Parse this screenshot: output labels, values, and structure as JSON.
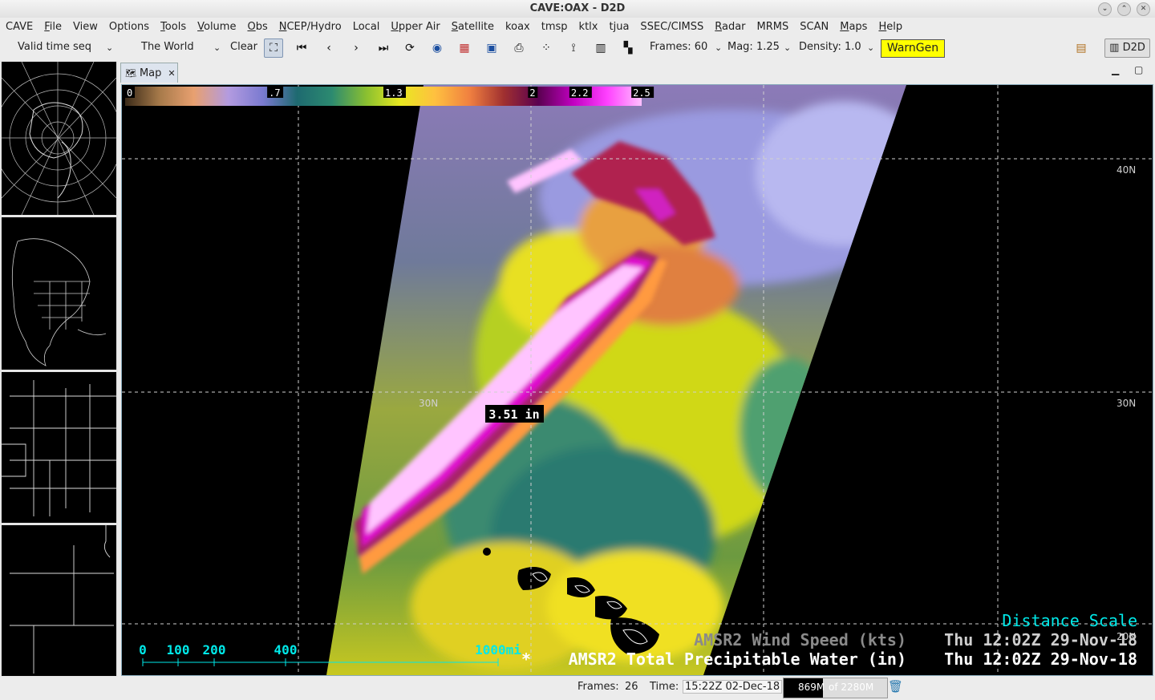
{
  "window": {
    "title": "CAVE:OAX - D2D"
  },
  "menu": [
    "CAVE",
    "File",
    "View",
    "Options",
    "Tools",
    "Volume",
    "Obs",
    "NCEP/Hydro",
    "Local",
    "Upper Air",
    "Satellite",
    "koax",
    "tmsp",
    "ktlx",
    "tjua",
    "SSEC/CIMSS",
    "Radar",
    "MRMS",
    "SCAN",
    "Maps",
    "Help"
  ],
  "toolbar": {
    "time_mode": "Valid time seq",
    "projection": "The World",
    "clear": "Clear",
    "frames": "Frames: 60",
    "mag": "Mag: 1.25",
    "density": "Density: 1.0",
    "warngen": "WarnGen",
    "perspective": "D2D"
  },
  "tab": {
    "label": "Map"
  },
  "colorbar": {
    "labels": [
      "0",
      ".7",
      "1.3",
      "2",
      "2.2",
      "2.5"
    ],
    "colors": [
      "#3a2a18",
      "#a77a4a",
      "#e8a070",
      "#b39be0",
      "#7a7ad0",
      "#1e6a70",
      "#2c8a70",
      "#8ac030",
      "#e8e820",
      "#ffc040",
      "#f08040",
      "#a03030",
      "#5a0050",
      "#c000c0",
      "#ff40ff",
      "#ffc0ff"
    ]
  },
  "map": {
    "readout": "3.51 in",
    "lat_labels": [
      "40N",
      "30N",
      "30N",
      "20N"
    ],
    "distance_scale_title": "Distance Scale",
    "distance_scale_ticks": [
      "0",
      "100",
      "200",
      "400",
      "1000mi"
    ],
    "legend": [
      {
        "product": "AMSR2 Wind Speed (kts)",
        "time": "Thu 12:02Z 29-Nov-18",
        "color": "#8a8a8a"
      },
      {
        "product": "AMSR2 Total Precipitable Water (in)",
        "time": "Thu 12:02Z 29-Nov-18",
        "color": "#ffffff"
      }
    ],
    "legend_marker": "*"
  },
  "status": {
    "frames_label": "Frames:",
    "frames_value": "26",
    "time_label": "Time:",
    "time_value": "15:22Z 02-Dec-18",
    "memory_used": "869M",
    "memory_total": "of 2280M"
  }
}
